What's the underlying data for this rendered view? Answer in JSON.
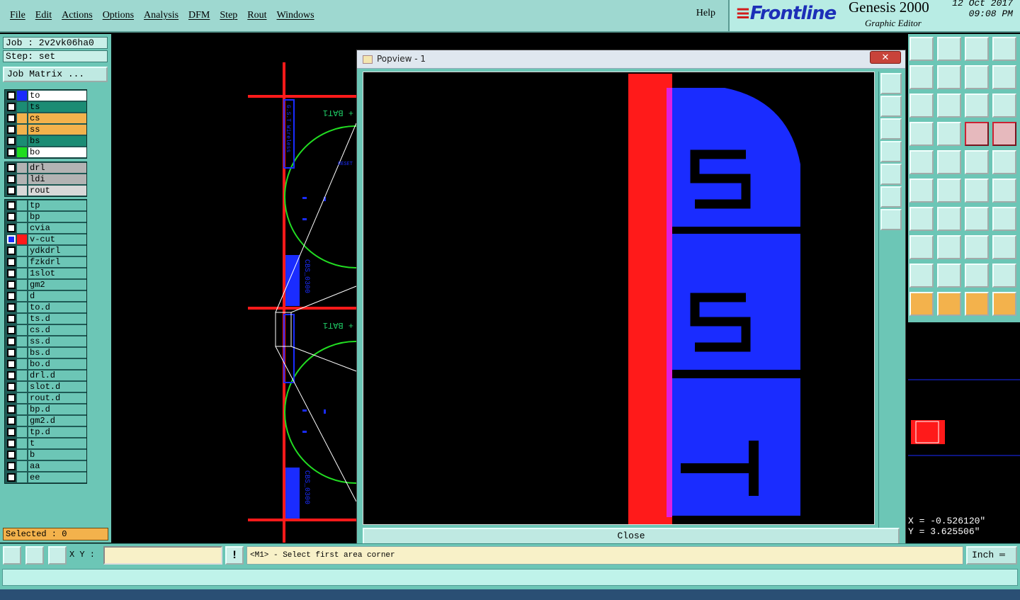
{
  "menu": {
    "items": [
      "File",
      "Edit",
      "Actions",
      "Options",
      "Analysis",
      "DFM",
      "Step",
      "Rout",
      "Windows"
    ],
    "help": "Help"
  },
  "brand": {
    "logo": "Frontline",
    "product": "Genesis 2000",
    "subtitle": "Graphic Editor",
    "date": "12 Oct 2017",
    "time": "09:08 PM"
  },
  "job": {
    "job_label": "Job : 2v2vk06ha0",
    "step_label": "Step: set",
    "matrix_button": "Job Matrix ..."
  },
  "layers": {
    "group1": [
      {
        "name": "to",
        "color": "#1a2cff",
        "bg": "#ffffff"
      },
      {
        "name": "ts",
        "color": "#1b8c74",
        "bg": "#1b8c74"
      },
      {
        "name": "cs",
        "color": "#f3b24c",
        "bg": "#f3b24c"
      },
      {
        "name": "ss",
        "color": "#f3b24c",
        "bg": "#f3b24c"
      },
      {
        "name": "bs",
        "color": "#1b8c74",
        "bg": "#1b8c74"
      },
      {
        "name": "bo",
        "color": "#1fdc1f",
        "bg": "#ffffff"
      }
    ],
    "group2": [
      {
        "name": "drl",
        "color": "#b3b3b3",
        "bg": "#b3b3b3"
      },
      {
        "name": "ldi",
        "color": "#b3b3b3",
        "bg": "#b3b3b3"
      },
      {
        "name": "rout",
        "color": "#d8d8d8",
        "bg": "#d8d8d8"
      }
    ],
    "group3": [
      {
        "name": "tp"
      },
      {
        "name": "bp"
      },
      {
        "name": "cvia"
      },
      {
        "name": "v-cut",
        "active": true,
        "color": "#ff1a1a"
      },
      {
        "name": "ydkdrl"
      },
      {
        "name": "fzkdrl"
      },
      {
        "name": "1slot"
      },
      {
        "name": "gm2"
      },
      {
        "name": "d"
      },
      {
        "name": "to.d"
      },
      {
        "name": "ts.d"
      },
      {
        "name": "cs.d"
      },
      {
        "name": "ss.d"
      },
      {
        "name": "bs.d"
      },
      {
        "name": "bo.d"
      },
      {
        "name": "drl.d"
      },
      {
        "name": "slot.d"
      },
      {
        "name": "rout.d"
      },
      {
        "name": "bp.d"
      },
      {
        "name": "gm2.d"
      },
      {
        "name": "tp.d"
      },
      {
        "name": "t"
      },
      {
        "name": "b"
      },
      {
        "name": "aa"
      },
      {
        "name": "ee"
      }
    ]
  },
  "selected_label": "Selected : 0",
  "popview": {
    "title": "Popview - 1",
    "close_label": "Close"
  },
  "canvas_text": {
    "bat1": "+ BAT1",
    "cbs": "CBS_0300",
    "reset": "RESET",
    "wireless": "G.S.T Wireless"
  },
  "coords": {
    "x": "X = -0.526120\"",
    "y": "Y = 3.625506\""
  },
  "bottombar": {
    "xy_label": "X Y :",
    "xy_value": "",
    "prompt": "<M1> - Select first area corner",
    "units": "Inch"
  },
  "colors": {
    "panel": "#6cc6b6",
    "vcut_red": "#ff1a1a",
    "copper_blue": "#1a2cff",
    "outline_green": "#22dd22"
  }
}
